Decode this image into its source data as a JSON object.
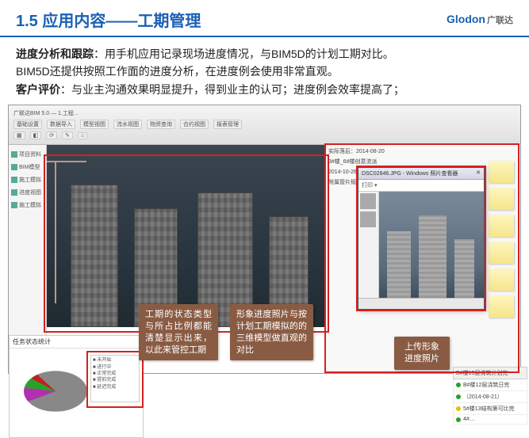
{
  "header": {
    "title": "1.5 应用内容——工期管理",
    "logo_en": "Glodon",
    "logo_cn": "广联达"
  },
  "description": {
    "line1_bold": "进度分析和跟踪",
    "line1_rest": "：用手机应用记录现场进度情况，与BIM5D的计划工期对比。",
    "line2": "BIM5D还提供按照工作面的进度分析，在进度例会使用非常直观。",
    "line3_bold": "客户评价",
    "line3_rest": "：与业主沟通效果明显提升，得到业主的认可；进度例会效率提高了；"
  },
  "toolbar": {
    "top_title": "广联达BIM 5.0 — 1.工程…",
    "menu1": "基础设置",
    "menu2": "数据导入",
    "menu3": "模型视图",
    "menu4": "流水视图",
    "menu5": "物资查询",
    "menu6": "合约视图",
    "menu7": "报表管理"
  },
  "sidebar": {
    "items": [
      "项目资料",
      "BIM模型",
      "施工模拟",
      "进度视图",
      "施工模拟"
    ]
  },
  "right_panel": {
    "date_label": "实际落后：2014-08-20",
    "info1": "3#楼_6#楼创意流派",
    "info2": "2014-10-26 23:00:00",
    "info3": "附属管片规划"
  },
  "photo_window": {
    "title": "DSC02846.JPG - Windows 照片查看器",
    "tool": "打印 ▾"
  },
  "pie_panel": {
    "title": "任务状态统计",
    "legend": [
      "■ 未开始",
      "■ 进行中",
      "■ 正常完成",
      "■ 提前完成",
      "■ 延迟完成"
    ]
  },
  "callouts": {
    "c1": "工期的状态类型与所占比例都能清楚显示出来，以此来管控工期",
    "c2": "形象进度照片与按计划工期模拟的的三维模型做直观的对比",
    "c3": "上传形象进度照片"
  },
  "tasklist": {
    "title": "B#楼15层浇筑计划完",
    "items": [
      {
        "color": "g",
        "text": "B#楼12层浇筑日完"
      },
      {
        "color": "g",
        "text": "（2014-08-21）"
      },
      {
        "color": "y",
        "text": "5#楼13结构第可比完"
      },
      {
        "color": "g",
        "text": "4#…"
      }
    ]
  },
  "chart_data": {
    "type": "pie",
    "title": "任务状态统计",
    "series": [
      {
        "name": "未开始",
        "value": 65,
        "color": "#888888"
      },
      {
        "name": "进行中",
        "value": 12,
        "color": "#b030b0"
      },
      {
        "name": "正常完成",
        "value": 10,
        "color": "#2aa02a"
      },
      {
        "name": "提前完成",
        "value": 5,
        "color": "#c02020"
      },
      {
        "name": "延迟完成",
        "value": 8,
        "color": "#888888"
      }
    ]
  }
}
